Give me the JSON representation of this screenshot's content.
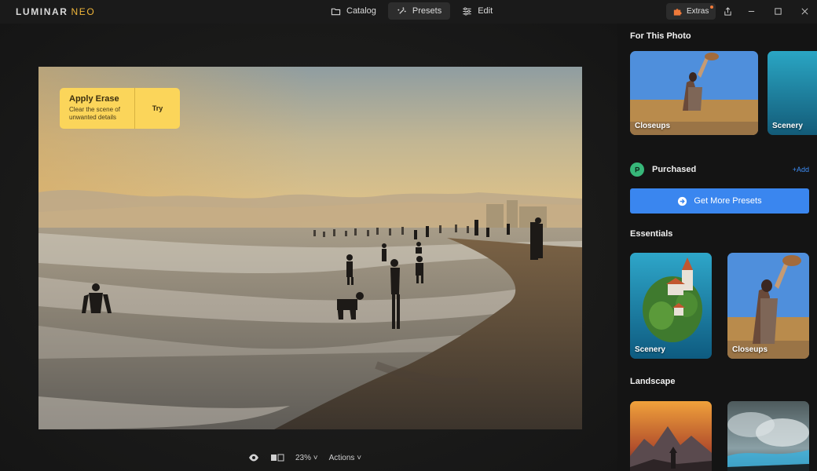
{
  "app": {
    "logo_main": "LUMINAR",
    "logo_accent": "NEO"
  },
  "tabs": [
    {
      "label": "Catalog",
      "icon": "folder-icon"
    },
    {
      "label": "Presets",
      "icon": "sparkle-icon",
      "active": true
    },
    {
      "label": "Edit",
      "icon": "sliders-icon"
    }
  ],
  "header": {
    "extras_label": "Extras"
  },
  "erase_card": {
    "title": "Apply Erase",
    "description": "Clear the scene of unwanted details",
    "try_label": "Try"
  },
  "bottom_bar": {
    "zoom": "23%",
    "actions_label": "Actions"
  },
  "panel": {
    "for_this_photo": {
      "title": "For This Photo",
      "tiles": [
        {
          "label": "Closeups"
        },
        {
          "label": "Scenery"
        }
      ]
    },
    "purchased": {
      "label": "Purchased",
      "add_label": "+Add"
    },
    "get_more": {
      "label": "Get More Presets"
    },
    "essentials": {
      "title": "Essentials",
      "tiles": [
        {
          "label": "Scenery"
        },
        {
          "label": "Closeups"
        }
      ]
    },
    "landscape": {
      "title": "Landscape"
    }
  },
  "colors": {
    "accent_blue": "#3a86ef",
    "erase_yellow": "#fbd55a",
    "purchased_green": "#37b779",
    "logo_accent": "#f0b63a"
  }
}
